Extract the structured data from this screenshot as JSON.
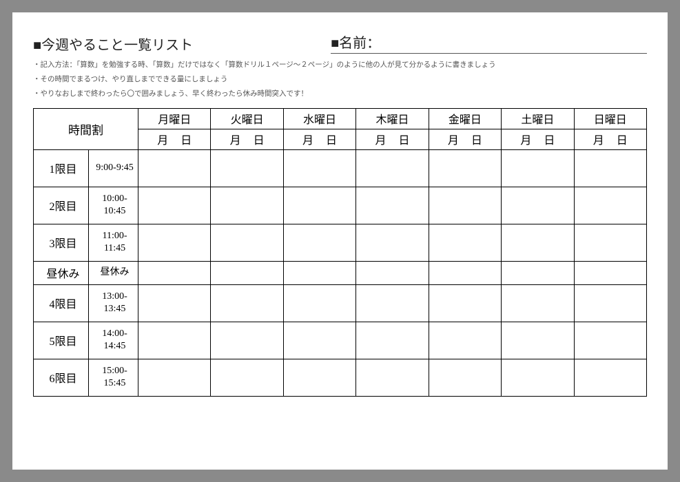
{
  "header": {
    "title": "■今週やること一覧リスト",
    "name_label": "■名前："
  },
  "notes": {
    "line1": "・記入方法：「算数」を勉強する時、「算数」だけではなく「算数ドリル１ページ～２ページ」のように他の人が見て分かるように書きましょう",
    "line2": "・その時間でまるつけ、やり直しまでできる量にしましょう",
    "line3": "・やりなおしまで終わったら〇で囲みましょう、早く終わったら休み時間突入です！"
  },
  "table": {
    "schedule_label": "時間割",
    "date_template": "月日",
    "days": {
      "mon": "月曜日",
      "tue": "火曜日",
      "wed": "水曜日",
      "thu": "木曜日",
      "fri": "金曜日",
      "sat": "土曜日",
      "sun": "日曜日"
    },
    "periods": {
      "p1": {
        "label": "1限目",
        "time": "9:00-9:45"
      },
      "p2": {
        "label": "2限目",
        "time": "10:00-10:45"
      },
      "p3": {
        "label": "3限目",
        "time": "11:00-11:45"
      },
      "lunch": {
        "label": "昼休み",
        "time": "昼休み"
      },
      "p4": {
        "label": "4限目",
        "time": "13:00-13:45"
      },
      "p5": {
        "label": "5限目",
        "time": "14:00-14:45"
      },
      "p6": {
        "label": "6限目",
        "time": "15:00-15:45"
      }
    }
  }
}
